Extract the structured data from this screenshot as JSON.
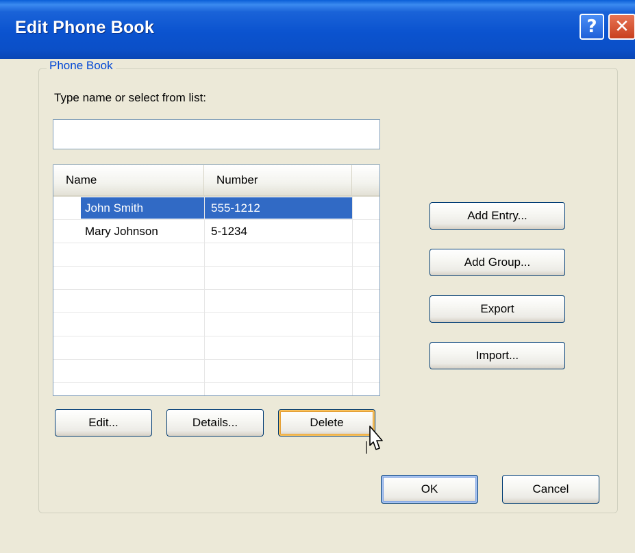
{
  "window": {
    "title": "Edit Phone Book",
    "help_glyph": "?",
    "close_glyph": "✕"
  },
  "group": {
    "legend": "Phone Book",
    "prompt": "Type name or select from list:",
    "search_value": ""
  },
  "list": {
    "columns": [
      "Name",
      "Number"
    ],
    "rows": [
      {
        "name": "John Smith",
        "number": "555-1212",
        "selected": true
      },
      {
        "name": "Mary Johnson",
        "number": "5-1234",
        "selected": false
      }
    ]
  },
  "buttons": {
    "edit": "Edit...",
    "details": "Details...",
    "delete": "Delete",
    "add_entry": "Add Entry...",
    "add_group": "Add Group...",
    "export": "Export",
    "import": "Import...",
    "ok": "OK",
    "cancel": "Cancel"
  },
  "colors": {
    "titlebar": "#0b53cf",
    "selection": "#316ac5",
    "legend": "#0046d5",
    "dialog_bg": "#ece9d8"
  },
  "icons": [
    "help-icon",
    "close-icon",
    "mouse-pointer-icon"
  ]
}
